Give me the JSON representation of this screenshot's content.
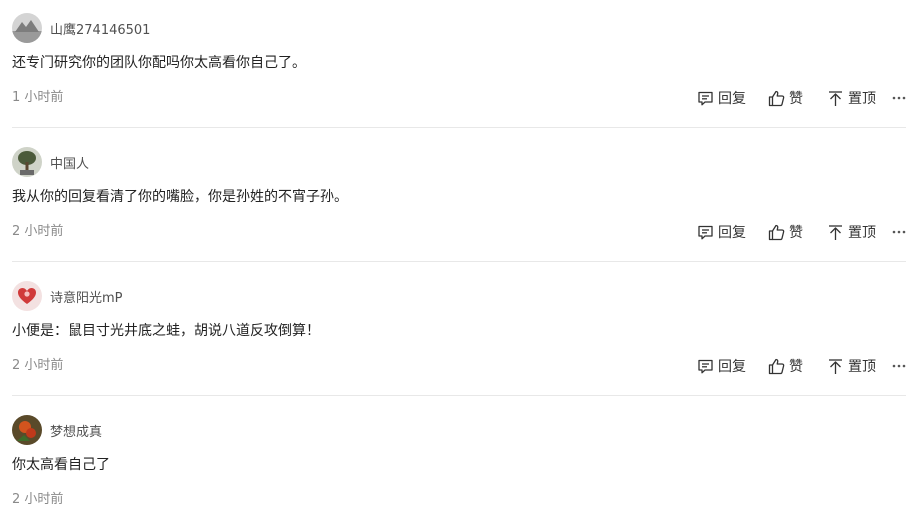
{
  "actions": {
    "reply": "回复",
    "like": "赞",
    "pin": "置顶"
  },
  "comments": [
    {
      "username": "山鹰274146501",
      "text": "还专门研究你的团队你配吗你太高看你自己了。",
      "time": "1 小时前",
      "avatar_colors": [
        "#c9c9c9",
        "#8d8d8d"
      ]
    },
    {
      "username": "中国人",
      "text": "我从你的回复看清了你的嘴脸，你是孙姓的不宵子孙。",
      "time": "2 小时前",
      "avatar_colors": [
        "#cfd3c8",
        "#4b5a3a"
      ]
    },
    {
      "username": "诗意阳光mP",
      "text": "小便是：鼠目寸光井底之蛙，胡说八道反攻倒算！",
      "time": "2 小时前",
      "avatar_colors": [
        "#f3e1e1",
        "#d03a3a"
      ]
    },
    {
      "username": "梦想成真",
      "text": "你太高看自己了",
      "time": "2 小时前",
      "avatar_colors": [
        "#5a4a2a",
        "#d2541e"
      ]
    }
  ]
}
